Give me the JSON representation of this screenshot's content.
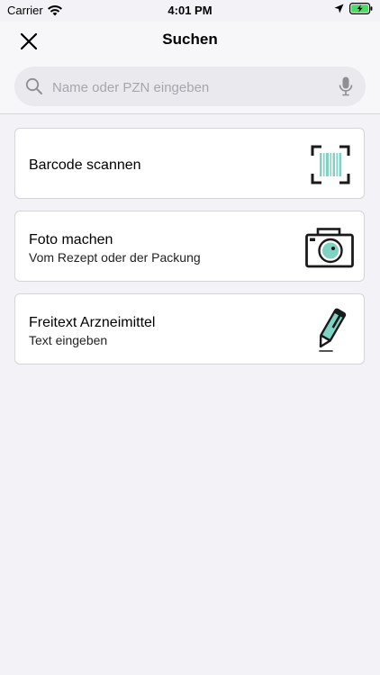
{
  "status_bar": {
    "carrier": "Carrier",
    "time": "4:01 PM",
    "icons": [
      "wifi-icon",
      "location-arrow-icon",
      "battery-charging-icon"
    ]
  },
  "header": {
    "title": "Suchen",
    "close_icon": "close-icon"
  },
  "search": {
    "placeholder": "Name oder PZN eingeben",
    "value": "",
    "search_icon": "search-icon",
    "mic_icon": "microphone-icon"
  },
  "options": [
    {
      "title": "Barcode scannen",
      "subtitle": "",
      "icon": "barcode-scan-icon"
    },
    {
      "title": "Foto machen",
      "subtitle": "Vom Rezept oder der Packung",
      "icon": "camera-icon"
    },
    {
      "title": "Freitext Arzneimittel",
      "subtitle": "Text eingeben",
      "icon": "pen-icon"
    }
  ],
  "colors": {
    "accent": "#7fd3c2",
    "background": "#f2f2f7",
    "card": "#ffffff"
  }
}
